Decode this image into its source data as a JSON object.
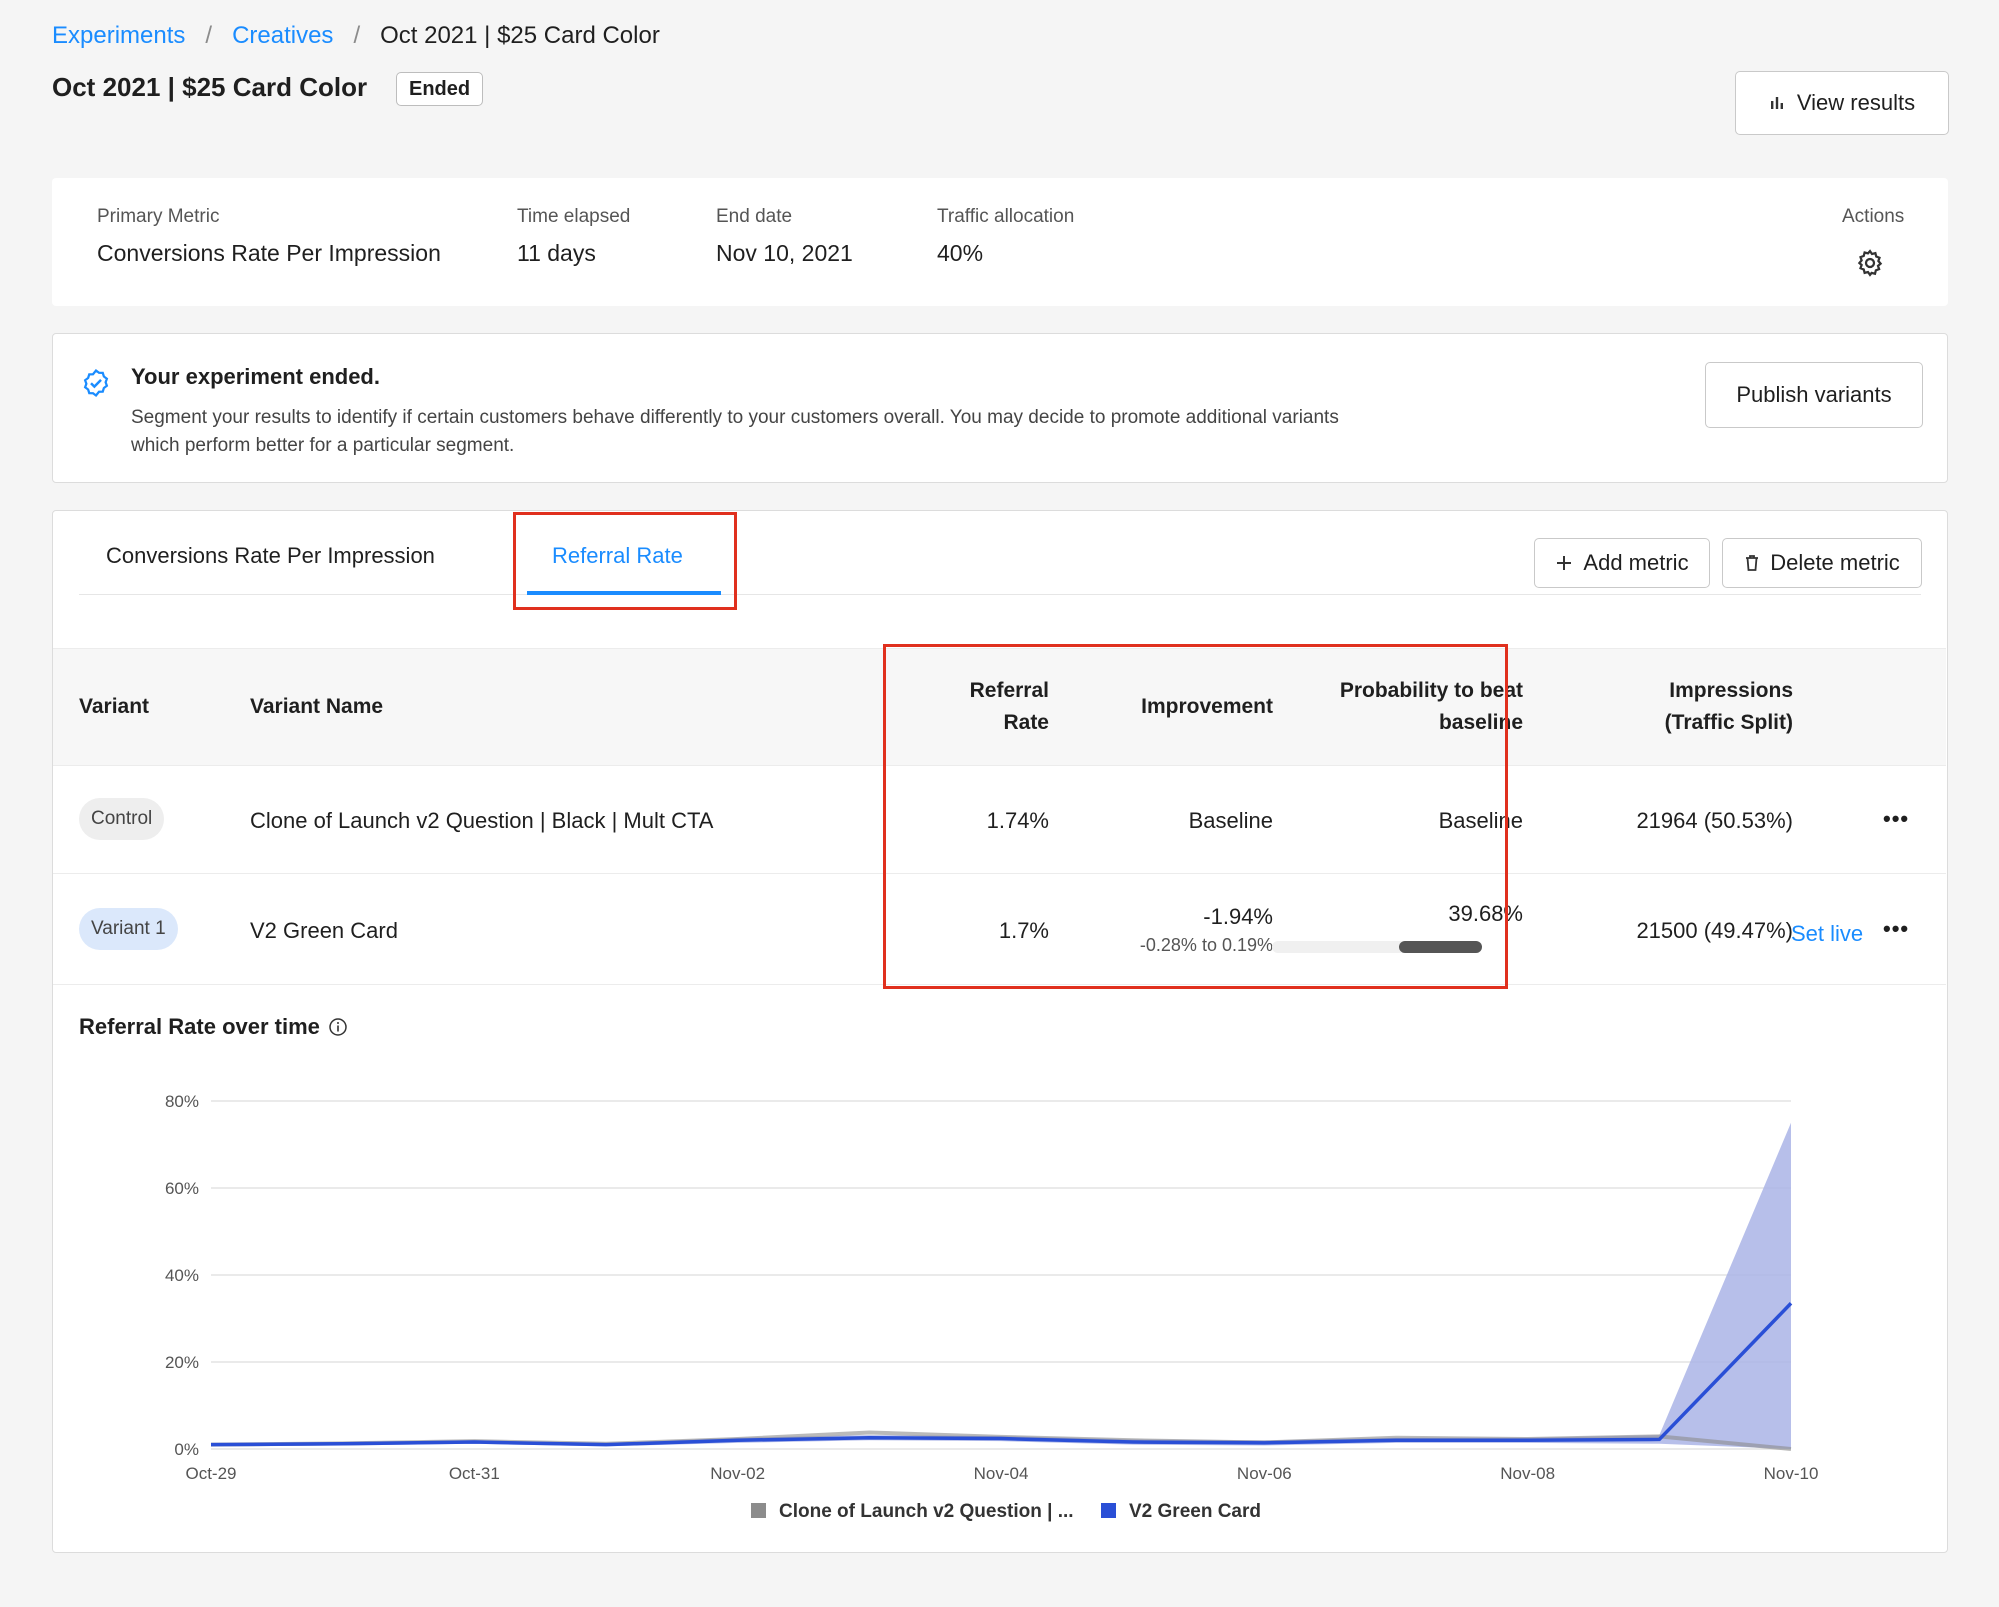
{
  "breadcrumb": {
    "items": [
      "Experiments",
      "Creatives"
    ],
    "current": "Oct 2021 | $25 Card Color"
  },
  "header": {
    "title": "Oct 2021 | $25 Card Color",
    "status": "Ended",
    "view_results_label": "View results"
  },
  "summary": {
    "primary_metric_label": "Primary Metric",
    "primary_metric_value": "Conversions Rate Per Impression",
    "time_elapsed_label": "Time elapsed",
    "time_elapsed_value": "11 days",
    "end_date_label": "End date",
    "end_date_value": "Nov 10, 2021",
    "traffic_label": "Traffic allocation",
    "traffic_value": "40%",
    "actions_label": "Actions"
  },
  "notice": {
    "title": "Your experiment ended.",
    "body": "Segment your results to identify if certain customers behave differently to your customers overall. You may decide to promote additional variants which perform better for a particular segment.",
    "publish_label": "Publish variants"
  },
  "tabs": [
    {
      "label": "Conversions Rate Per Impression"
    },
    {
      "label": "Referral Rate"
    }
  ],
  "toolbar": {
    "add_metric_label": "Add metric",
    "delete_metric_label": "Delete metric"
  },
  "table": {
    "headers": {
      "variant": "Variant",
      "variant_name": "Variant Name",
      "rate_1": "Referral",
      "rate_2": "Rate",
      "improvement": "Improvement",
      "prob_1": "Probability to beat",
      "prob_2": "baseline",
      "imp_1": "Impressions",
      "imp_2": "(Traffic Split)"
    },
    "rows": [
      {
        "variant": "Control",
        "name": "Clone of Launch v2 Question | Black | Mult CTA",
        "rate": "1.74%",
        "improvement": "Baseline",
        "improvement_range": "",
        "probability": "Baseline",
        "probability_fill": null,
        "impressions": "21964 (50.53%)",
        "set_live": ""
      },
      {
        "variant": "Variant 1",
        "name": "V2 Green Card",
        "rate": "1.7%",
        "improvement": "-1.94%",
        "improvement_range": "-0.28% to 0.19%",
        "probability": "39.68%",
        "probability_fill": 0.3968,
        "impressions": "21500 (49.47%)",
        "set_live": "Set live"
      }
    ]
  },
  "chart_title": "Referral Rate over time",
  "chart_data": {
    "type": "line",
    "x": [
      "Oct-29",
      "Oct-30",
      "Oct-31",
      "Nov-01",
      "Nov-02",
      "Nov-03",
      "Nov-04",
      "Nov-05",
      "Nov-06",
      "Nov-07",
      "Nov-08",
      "Nov-09",
      "Nov-10"
    ],
    "xticks": [
      "Oct-29",
      "Oct-31",
      "Nov-02",
      "Nov-04",
      "Nov-06",
      "Nov-08",
      "Nov-10"
    ],
    "yticks": [
      "0%",
      "20%",
      "40%",
      "60%",
      "80%"
    ],
    "ylim": [
      0,
      80
    ],
    "series": [
      {
        "name": "Clone of Launch v2  Question | ...",
        "color": "#8c8c8c",
        "values": [
          1.0,
          1.3,
          1.8,
          1.2,
          2.3,
          3.8,
          2.8,
          2.0,
          1.5,
          2.6,
          2.3,
          2.9,
          0.0
        ]
      },
      {
        "name": "V2 Green Card",
        "color": "#2a4fd6",
        "values": [
          1.0,
          1.2,
          1.6,
          1.0,
          2.0,
          2.6,
          2.4,
          1.6,
          1.4,
          2.0,
          2.0,
          2.2,
          33.5
        ],
        "band_upper": [
          1.4,
          1.6,
          2.0,
          1.4,
          2.6,
          3.2,
          3.0,
          2.2,
          2.0,
          2.6,
          2.6,
          3.2,
          75.0
        ],
        "band_lower": [
          0.6,
          0.8,
          1.2,
          0.6,
          1.4,
          2.0,
          1.8,
          1.0,
          0.8,
          1.4,
          1.4,
          1.2,
          0.0
        ]
      }
    ]
  },
  "icons": {
    "bar_chart": "bar-chart-icon",
    "gear": "gear-icon",
    "verified": "verified-check-icon",
    "plus": "plus-icon",
    "trash": "trash-icon",
    "info": "info-icon",
    "more": "more-horizontal-icon"
  },
  "colors": {
    "link": "#1a8cff",
    "highlight": "#e0301e",
    "variant_pill": "#dbe8fb",
    "control_pill": "#eeeeee"
  }
}
